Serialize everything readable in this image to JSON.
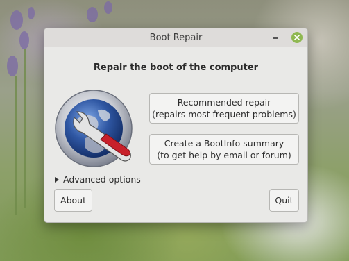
{
  "window": {
    "title": "Boot Repair",
    "heading": "Repair the boot of the computer"
  },
  "buttons": {
    "recommended_line1": "Recommended repair",
    "recommended_line2": "(repairs most frequent problems)",
    "bootinfo_line1": "Create a BootInfo summary",
    "bootinfo_line2": "(to get help by email or forum)",
    "about": "About",
    "quit": "Quit"
  },
  "advanced": {
    "label": "Advanced options"
  },
  "icons": {
    "close": "close-icon",
    "minimize": "minimize-icon",
    "logo": "boot-repair-logo-icon",
    "expander": "triangle-right-icon"
  },
  "colors": {
    "close_button": "#8fb851",
    "wrench_red": "#c8202a",
    "globe_blue": "#2f57a3"
  }
}
